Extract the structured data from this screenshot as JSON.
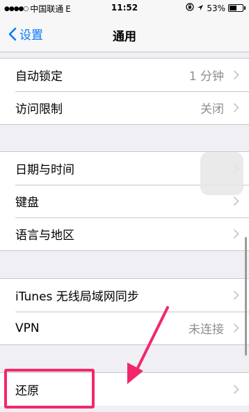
{
  "status_bar": {
    "signal_dots": "●●●●○",
    "carrier": "中国联通",
    "network": "E",
    "time": "11:52",
    "battery": "53%",
    "battery_level": 0.53
  },
  "nav": {
    "back_label": "设置",
    "title": "通用"
  },
  "group1": [
    {
      "label": "自动锁定",
      "value": "1 分钟"
    },
    {
      "label": "访问限制",
      "value": "关闭"
    }
  ],
  "group2": [
    {
      "label": "日期与时间"
    },
    {
      "label": "键盘"
    },
    {
      "label": "语言与地区"
    }
  ],
  "group3": [
    {
      "label": "iTunes 无线局域网同步"
    },
    {
      "label": "VPN",
      "value": "未连接"
    }
  ],
  "group4": [
    {
      "label": "还原"
    }
  ],
  "colors": {
    "accent": "#007aff",
    "highlight": "#f2276b"
  }
}
